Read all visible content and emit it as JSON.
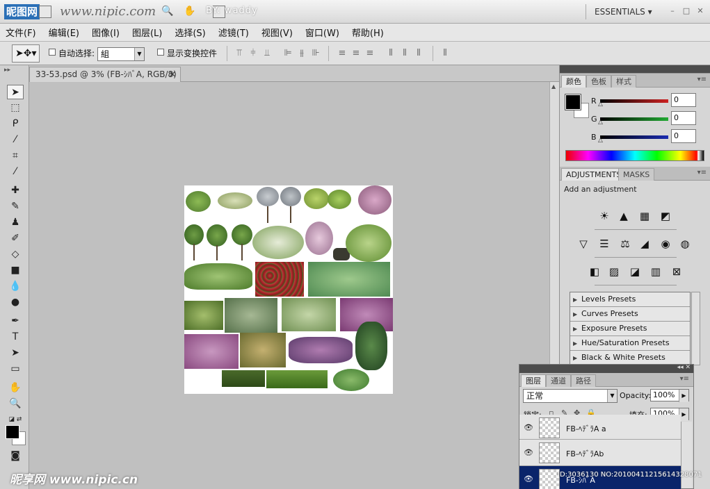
{
  "titlebar": {
    "logo": "昵图网",
    "site": "www.nipic.com",
    "ext": "BY: waddy",
    "workspace": "ESSENTIALS"
  },
  "menu": [
    "文件(F)",
    "编辑(E)",
    "图像(I)",
    "图层(L)",
    "选择(S)",
    "滤镜(T)",
    "视图(V)",
    "窗口(W)",
    "帮助(H)"
  ],
  "options": {
    "auto_select_label": "自动选择:",
    "auto_select_value": "組",
    "show_transform_label": "显示变换控件"
  },
  "document": {
    "tab_title": "33-53.psd @ 3% (FB-ｼﾊﾞA, RGB/8)"
  },
  "color_panel": {
    "tabs": [
      "颜色",
      "色板",
      "样式"
    ],
    "active_tab": "颜色",
    "channels": [
      {
        "label": "R",
        "value": "0",
        "color": "#cc2222"
      },
      {
        "label": "G",
        "value": "0",
        "color": "#22aa33"
      },
      {
        "label": "B",
        "value": "0",
        "color": "#1a2bb0"
      }
    ]
  },
  "adjustments": {
    "tabs": [
      "ADJUSTMENTS",
      "MASKS"
    ],
    "title": "Add an adjustment",
    "presets": [
      "Levels Presets",
      "Curves Presets",
      "Exposure Presets",
      "Hue/Saturation Presets",
      "Black & White Presets"
    ]
  },
  "layers": {
    "tabs": [
      "图层",
      "通道",
      "路径"
    ],
    "blend_mode": "正常",
    "opacity_label": "Opacity:",
    "opacity": "100%",
    "lock_label": "锁定:",
    "fill_label": "填充:",
    "fill": "100%",
    "items": [
      {
        "name": "FB-ﾍﾃﾞﾗA a",
        "selected": false
      },
      {
        "name": "FB-ﾍﾃﾞﾗAb",
        "selected": false
      },
      {
        "name": "FB-ｼﾊﾞA",
        "selected": true
      }
    ]
  },
  "watermark": {
    "bottom": "昵享网 www.nipic.cn",
    "id": "ID:3036130 NO:20100411215614328071"
  }
}
